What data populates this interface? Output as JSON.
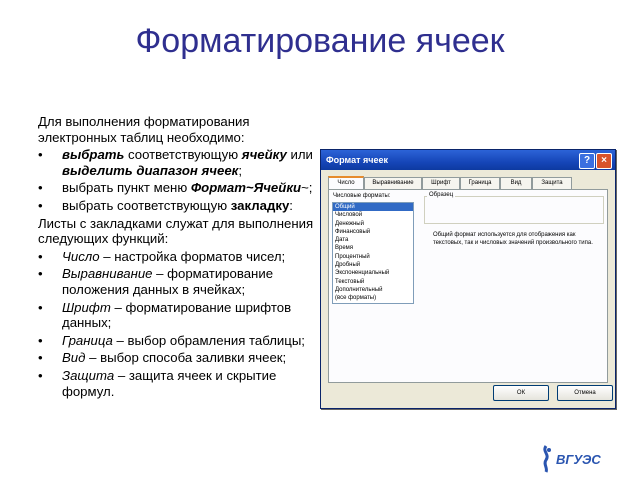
{
  "slide": {
    "title": "Форматирование ячеек",
    "intro": "Для выполнения форматирования электронных таблиц необходимо:",
    "steps": [
      {
        "a": "выбрать",
        "b": " соответствующую ",
        "c": "ячейку",
        "d": " или ",
        "e": "выделить диапазон ячеек",
        "f": ";"
      },
      {
        "a": "выбрать пункт меню ",
        "b": "Формат~Ячейки",
        "c": "~;"
      },
      {
        "a": "выбрать соответствующую ",
        "b": "закладку",
        "c": ":"
      }
    ],
    "tabs_intro": "Листы с закладками служат для выполнения следующих функций:",
    "functions": [
      {
        "name": "Число",
        "desc": " – настройка форматов чисел;"
      },
      {
        "name": "Выравнивание",
        "desc": " – форматирование положения данных в ячейках;"
      },
      {
        "name": "Шрифт",
        "desc": " – форматирование шрифтов данных;"
      },
      {
        "name": "Граница",
        "desc": " – выбор обрамления таблицы;"
      },
      {
        "name": "Вид",
        "desc": " – выбор способа заливки ячеек;"
      },
      {
        "name": "Защита",
        "desc": " – защита ячеек и скрытие формул."
      }
    ]
  },
  "dialog": {
    "title": "Формат ячеек",
    "help": "?",
    "close": "×",
    "tabs": [
      "Число",
      "Выравнивание",
      "Шрифт",
      "Граница",
      "Вид",
      "Защита"
    ],
    "categories_label": "Числовые форматы:",
    "categories": [
      "Общий",
      "Числовой",
      "Денежный",
      "Финансовый",
      "Дата",
      "Время",
      "Процентный",
      "Дробный",
      "Экспоненциальный",
      "Текстовый",
      "Дополнительный",
      "(все форматы)"
    ],
    "selected_category": "Общий",
    "sample_label": "Образец",
    "description": "Общий формат используется для отображения как текстовых, так и числовых значений произвольного типа.",
    "ok": "ОК",
    "cancel": "Отмена"
  },
  "logo": {
    "text": "ВГУЭС",
    "color": "#2a55b0"
  }
}
